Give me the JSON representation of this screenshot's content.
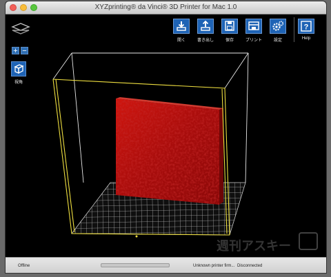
{
  "window": {
    "title": "XYZprinting® da Vinci® 3D Printer for Mac 1.0"
  },
  "left_controls": {
    "zoom_in": "+",
    "zoom_out": "−",
    "view_label": "視角"
  },
  "toolbar": {
    "items": [
      {
        "label": "開く",
        "icon": "open-icon"
      },
      {
        "label": "書き出し",
        "icon": "export-icon"
      },
      {
        "label": "保存",
        "icon": "save-icon"
      },
      {
        "label": "プリント",
        "icon": "print-icon"
      },
      {
        "label": "設定",
        "icon": "settings-icon"
      },
      {
        "label": "Help",
        "icon": "help-icon"
      }
    ]
  },
  "status": {
    "connection_state": "Offline",
    "progress": 0,
    "firmware": "Unknown printer firm...",
    "connection": "Disconnected"
  },
  "watermark": "週刊アスキー",
  "colors": {
    "accent": "#1e63b5",
    "build_volume": "#f0e040",
    "model": "#b8100f",
    "platform_grid": "#dcdcdc",
    "background": "#000000"
  }
}
